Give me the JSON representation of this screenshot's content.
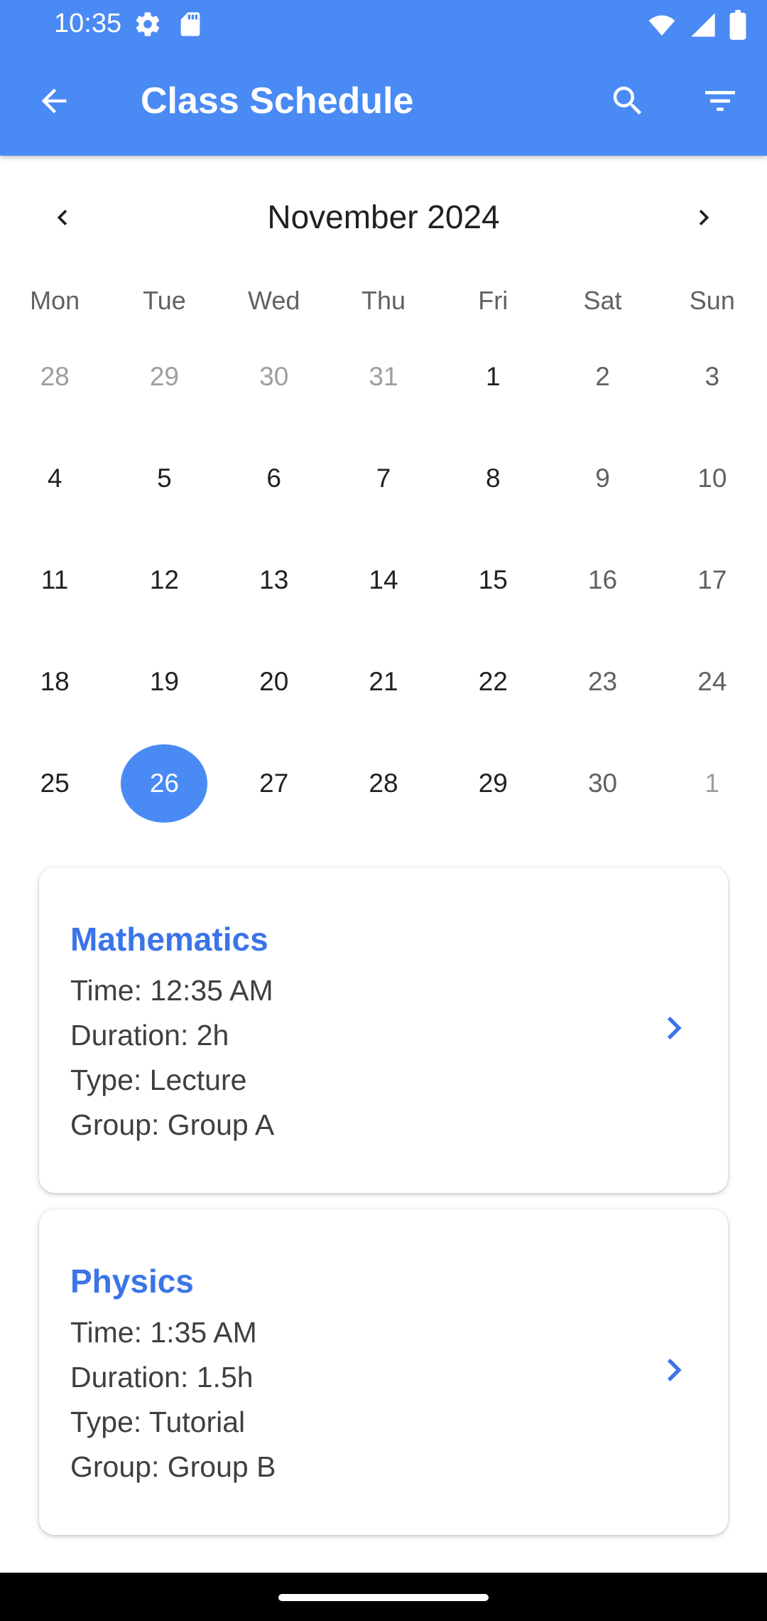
{
  "status_bar": {
    "time": "10:35",
    "left_icons": [
      "gear-icon",
      "sd-card-icon"
    ],
    "right_icons": [
      "wifi-icon",
      "signal-icon",
      "battery-icon"
    ]
  },
  "app_bar": {
    "title": "Class Schedule",
    "color": "#4a8af4",
    "actions": [
      "back-arrow-icon",
      "search-icon",
      "filter-icon"
    ]
  },
  "calendar": {
    "month_label": "November 2024",
    "weekdays": [
      "Mon",
      "Tue",
      "Wed",
      "Thu",
      "Fri",
      "Sat",
      "Sun"
    ],
    "weeks": [
      [
        "28",
        "29",
        "30",
        "31",
        "1",
        "2",
        "3"
      ],
      [
        "4",
        "5",
        "6",
        "7",
        "8",
        "9",
        "10"
      ],
      [
        "11",
        "12",
        "13",
        "14",
        "15",
        "16",
        "17"
      ],
      [
        "18",
        "19",
        "20",
        "21",
        "22",
        "23",
        "24"
      ],
      [
        "25",
        "26",
        "27",
        "28",
        "29",
        "30",
        "1"
      ]
    ],
    "selected_day": "26",
    "selected_color": "#4a8af4"
  },
  "classes": [
    {
      "title": "Mathematics",
      "time": "Time: 12:35 AM",
      "duration": "Duration: 2h",
      "type": "Type: Lecture",
      "group": "Group: Group A"
    },
    {
      "title": "Physics",
      "time": "Time: 1:35 AM",
      "duration": "Duration: 1.5h",
      "type": "Type: Tutorial",
      "group": "Group: Group B"
    }
  ]
}
